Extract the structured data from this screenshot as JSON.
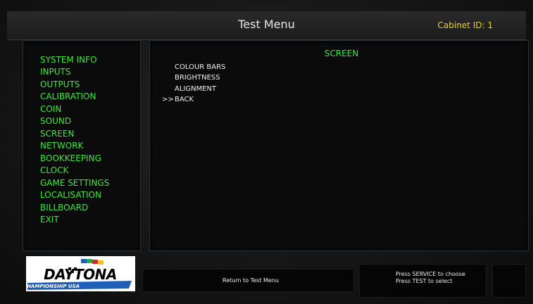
{
  "header": {
    "title": "Test Menu",
    "cabinet_id": "Cabinet ID: 1"
  },
  "sidebar": {
    "items": [
      {
        "label": "SYSTEM INFO"
      },
      {
        "label": "INPUTS"
      },
      {
        "label": "OUTPUTS"
      },
      {
        "label": "CALIBRATION"
      },
      {
        "label": "COIN"
      },
      {
        "label": "SOUND"
      },
      {
        "label": "SCREEN"
      },
      {
        "label": "NETWORK"
      },
      {
        "label": "BOOKKEEPING"
      },
      {
        "label": "CLOCK"
      },
      {
        "label": "GAME SETTINGS"
      },
      {
        "label": "LOCALISATION"
      },
      {
        "label": "BILLBOARD"
      },
      {
        "label": "EXIT"
      }
    ]
  },
  "main": {
    "section_title": "SCREEN",
    "cursor": ">>",
    "options": [
      {
        "label": "COLOUR BARS"
      },
      {
        "label": "BRIGHTNESS"
      },
      {
        "label": "ALIGNMENT"
      },
      {
        "label": "BACK"
      }
    ],
    "selected": "BACK"
  },
  "logo": {
    "title": "DAYTONA",
    "subtitle": "CHAMPIONSHIP USA"
  },
  "footer": {
    "return_label": "Return to Test Menu",
    "help_line_1": "Press SERVICE to choose",
    "help_line_2": "Press TEST to select"
  },
  "colors": {
    "menu_green": "#3ee83e",
    "cabinet_yellow": "#e6d21a",
    "text_white": "#f0f0f0",
    "logo_blue": "#1f5fb8",
    "logo_black": "#000000"
  }
}
